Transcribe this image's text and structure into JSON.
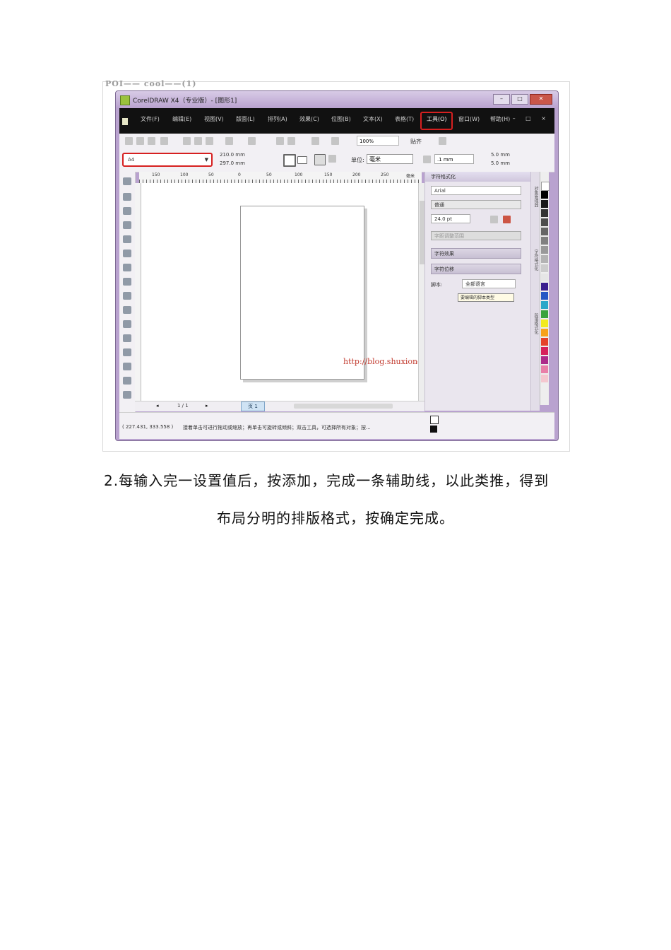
{
  "screenshot": {
    "watermark_top": "POI—— cool——(1)",
    "window_title": "CorelDRAW X4（专业版）- [图形1]",
    "window_buttons": [
      "–",
      "□",
      "✕"
    ],
    "menu": [
      "文件(F)",
      "编辑(E)",
      "视图(V)",
      "版面(L)",
      "排列(A)",
      "效果(C)",
      "位图(B)",
      "文本(X)",
      "表格(T)",
      "工具(O)",
      "窗口(W)",
      "帮助(H)"
    ],
    "menu_highlighted": "工具(O)",
    "menu_right_controls": "– □ ×",
    "zoom": "100%",
    "snap_label": "贴齐",
    "paper_size": "A4",
    "width": "210.0 mm",
    "height": "297.0 mm",
    "unit_label": "单位:",
    "unit_value": "毫米",
    "nudge": ".1 mm",
    "dup_x": "5.0 mm",
    "dup_y": "5.0 mm",
    "ruler_labels": [
      "150",
      "100",
      "50",
      "0",
      "50",
      "100",
      "150",
      "200",
      "250",
      "毫米"
    ],
    "docker": {
      "title": "字符格式化",
      "font": "Arial",
      "style": "普通",
      "size": "24.0 pt",
      "range_label": "字距调整范围",
      "section_effects": "字符效果",
      "section_offset": "字符位移",
      "script_label": "脚本:",
      "script_value": "全部语言",
      "tooltip": "要编辑的脚本类型"
    },
    "vertical_tabs": [
      "对象管理器",
      "字符格式化",
      "段落格式化"
    ],
    "page_counter": "1 / 1",
    "page_tab": "页 1",
    "canvas_url": "http://blog.shuxiong.net",
    "status_coords": "( 227.431, 333.558 )",
    "status_hint": "接着单击可进行拖动或缩放；再单击可旋转或倾斜；双击工具，可选择所有对象；按...",
    "palette_colors": [
      "#ffffff",
      "#000000",
      "#1a1a1a",
      "#333333",
      "#4d4d4d",
      "#666666",
      "#808080",
      "#999999",
      "#b3b3b3",
      "#cccccc",
      "#e6e6e6",
      "#3a1e8f",
      "#2458c4",
      "#2aa7c9",
      "#39a33b",
      "#f2ea1e",
      "#f7a21b",
      "#e5422a",
      "#d6215b",
      "#ad2b8a",
      "#e97fa8",
      "#f4c7cf"
    ]
  },
  "caption": {
    "line1": "2.每输入完一设置值后，按添加，完成一条辅助线，以此类推，得到",
    "line2": "布局分明的排版格式，按确定完成。"
  }
}
